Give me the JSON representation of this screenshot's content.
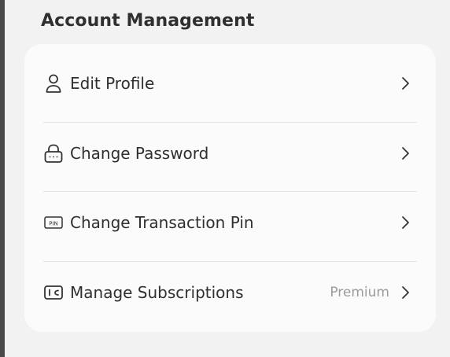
{
  "section": {
    "title": "Account Management"
  },
  "items": [
    {
      "label": "Edit Profile",
      "icon": "person-icon",
      "badge": ""
    },
    {
      "label": "Change Password",
      "icon": "lock-icon",
      "badge": ""
    },
    {
      "label": "Change Transaction Pin",
      "icon": "pin-icon",
      "pin_text": "PIN",
      "badge": ""
    },
    {
      "label": "Manage Subscriptions",
      "icon": "wallet-icon",
      "badge": "Premium"
    }
  ],
  "colors": {
    "background": "#f2f2f2",
    "card": "#fbfbfb",
    "text": "#2f2f2f",
    "muted": "#9b9b9b",
    "divider": "#e4e4e4"
  }
}
